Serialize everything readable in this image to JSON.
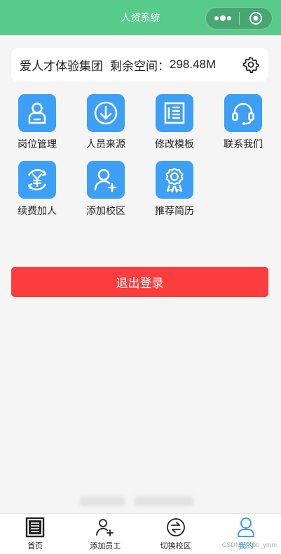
{
  "header": {
    "title": "人资系统"
  },
  "info": {
    "company": "爱人才体验集团",
    "space_label": "剩余空间：",
    "space_value": "298.48M"
  },
  "grid": [
    {
      "label": "岗位管理",
      "icon": "person-badge-icon"
    },
    {
      "label": "人员来源",
      "icon": "download-circle-icon"
    },
    {
      "label": "修改模板",
      "icon": "document-list-icon"
    },
    {
      "label": "联系我们",
      "icon": "headset-icon"
    },
    {
      "label": "续费加人",
      "icon": "yuan-renew-icon"
    },
    {
      "label": "添加校区",
      "icon": "person-add-icon"
    },
    {
      "label": "推荐简历",
      "icon": "award-ribbon-icon"
    }
  ],
  "logout_label": "退出登录",
  "tabbar": [
    {
      "label": "首页",
      "icon": "home-doc-icon"
    },
    {
      "label": "添加员工",
      "icon": "add-employee-icon"
    },
    {
      "label": "切换校区",
      "icon": "switch-campus-icon"
    },
    {
      "label": "我的",
      "icon": "profile-icon"
    }
  ],
  "watermark": "CSDN @jybb_ymm",
  "colors": {
    "header": "#57cb8a",
    "icon_blue": "#3d9ff5",
    "logout_red": "#fd3c3d",
    "active_tab": "#3d9ff5"
  }
}
